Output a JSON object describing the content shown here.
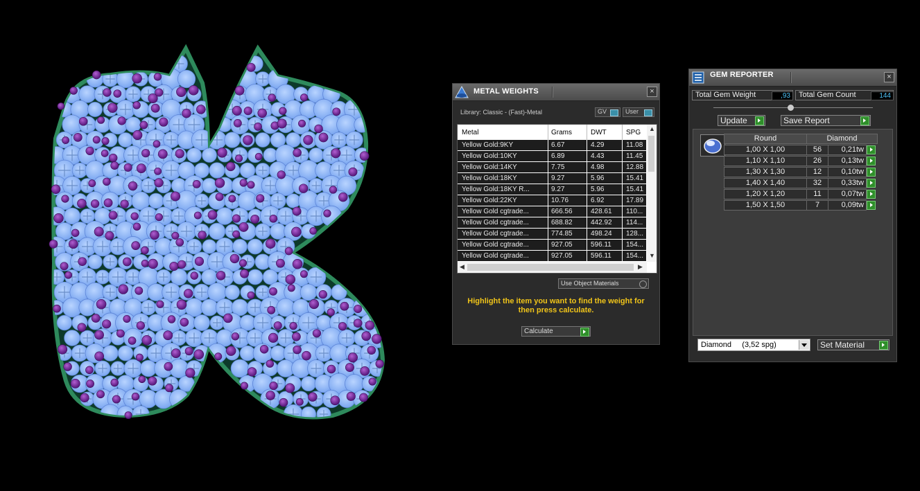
{
  "metal_weights": {
    "title": "METAL WEIGHTS",
    "library": "Library: Classic - (Fast)-Metal",
    "gv_label": "GV",
    "user_label": "User",
    "columns": [
      "Metal",
      "Grams",
      "DWT",
      "SPG"
    ],
    "rows": [
      [
        "Yellow Gold:9KY",
        "6.67",
        "4.29",
        "11.08"
      ],
      [
        "Yellow Gold:10KY",
        "6.89",
        "4.43",
        "11.45"
      ],
      [
        "Yellow Gold:14KY",
        "7.75",
        "4.98",
        "12.88"
      ],
      [
        "Yellow Gold:18KY",
        "9.27",
        "5.96",
        "15.41"
      ],
      [
        "Yellow Gold:18KY R...",
        "9.27",
        "5.96",
        "15.41"
      ],
      [
        "Yellow Gold:22KY",
        "10.76",
        "6.92",
        "17.89"
      ],
      [
        "Yellow Gold cgtrade...",
        "666.56",
        "428.61",
        "110..."
      ],
      [
        "Yellow Gold cgtrade...",
        "688.82",
        "442.92",
        "114..."
      ],
      [
        "Yellow Gold cgtrade...",
        "774.85",
        "498.24",
        "128..."
      ],
      [
        "Yellow Gold cgtrade...",
        "927.05",
        "596.11",
        "154..."
      ],
      [
        "Yellow Gold cgtrade...",
        "927.05",
        "596.11",
        "154..."
      ]
    ],
    "use_object_materials": "Use Object Materials",
    "instruction": "Highlight the item you want to find the weight for then press calculate.",
    "calculate": "Calculate"
  },
  "gem_reporter": {
    "title": "GEM REPORTER",
    "total_weight_label": "Total Gem Weight",
    "total_weight_value": ",93",
    "total_count_label": "Total Gem Count",
    "total_count_value": "144",
    "update": "Update",
    "save_report": "Save Report",
    "shape_header": "Round",
    "material_header": "Diamond",
    "rows": [
      [
        "1,00 X 1,00",
        "56",
        "0,21tw"
      ],
      [
        "1,10 X 1,10",
        "26",
        "0,13tw"
      ],
      [
        "1,30 X 1,30",
        "12",
        "0,10tw"
      ],
      [
        "1,40 X 1,40",
        "32",
        "0,33tw"
      ],
      [
        "1,20 X 1,20",
        "11",
        "0,07tw"
      ],
      [
        "1,50 X 1,50",
        "7",
        "0,09tw"
      ]
    ],
    "material_select": "Diamond     (3,52 spg)",
    "set_material": "Set Material"
  }
}
